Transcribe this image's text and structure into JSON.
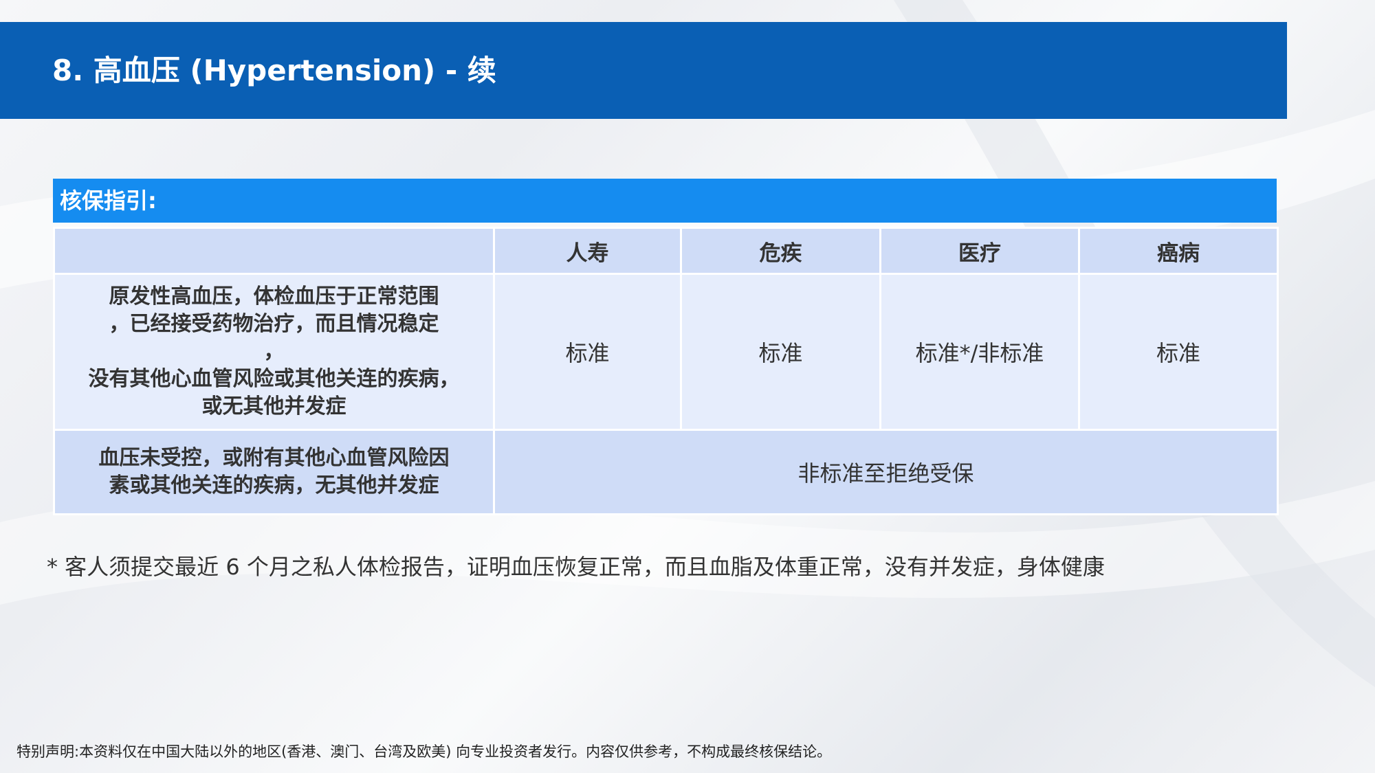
{
  "header": {
    "title": "8. 高血压 (Hypertension)  - 续"
  },
  "guide": {
    "title": "核保指引:"
  },
  "table": {
    "columns": [
      "",
      "人寿",
      "危疾",
      "医疗",
      "癌病"
    ],
    "rows": [
      {
        "condition_lines": [
          "原发性高血压，体检血压于正常范围",
          "，已经接受药物治疗，而且情况稳定",
          "，",
          "没有其他心血管风险或其他关连的疾病，",
          "或无其他并发症"
        ],
        "results": [
          "标准",
          "标准",
          "标准*/非标准",
          "标准"
        ]
      },
      {
        "condition_lines": [
          "血压未受控，或附有其他心血管风险因",
          "素或其他关连的疾病，无其他并发症"
        ],
        "merged_result": "非标准至拒绝受保"
      }
    ]
  },
  "footnote": "* 客人须提交最近 6 个月之私人体检报告，证明血压恢复正常，而且血脂及体重正常，没有并发症，身体健康",
  "disclaimer": "特别声明:本资料仅在中国大陆以外的地区(香港、澳门、台湾及欧美) 向专业投资者发行。内容仅供参考，不构成最终核保结论。",
  "colors": {
    "header_bg": "#0a5fb4",
    "guide_bg": "#158cf0",
    "table_header_bg": "#cfdcf7",
    "table_row_bg": "#e6edfc"
  }
}
